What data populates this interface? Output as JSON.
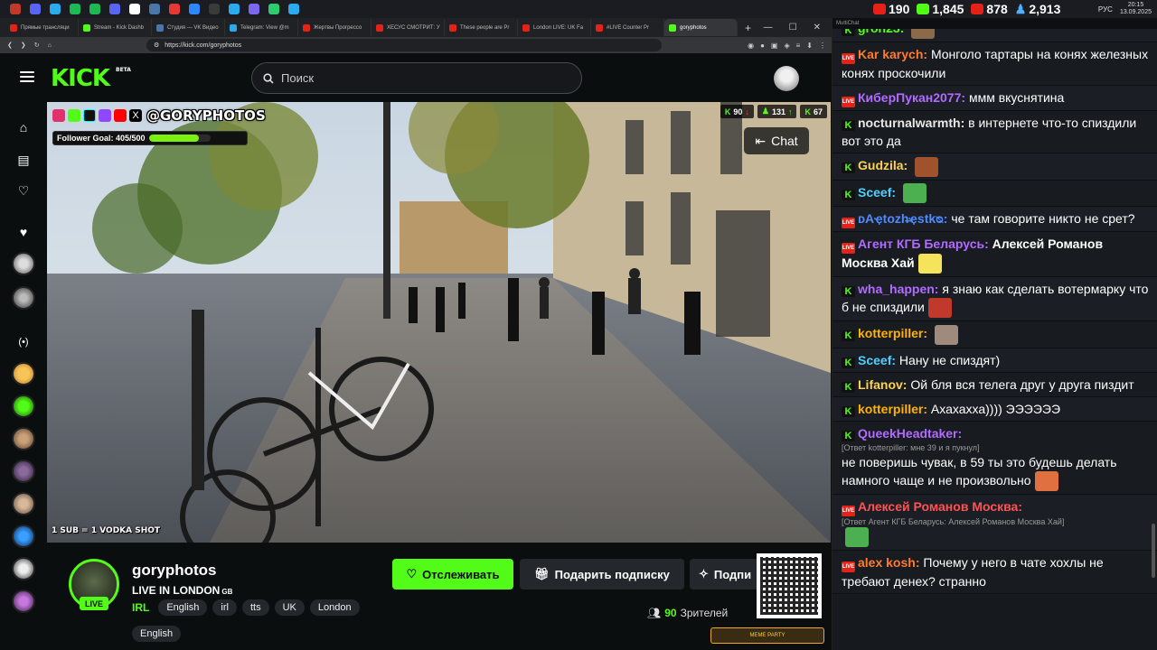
{
  "taskbar": {
    "icon_colors": [
      "#c0392b",
      "#5865f2",
      "#2aabee",
      "#1db954",
      "#1db954",
      "#5865f2",
      "#ffffff",
      "#4a76a8",
      "#e53935",
      "#2d88ff",
      "#3a3a3a",
      "#2aabee",
      "#7b68ee",
      "#2ecc71",
      "#2aabee"
    ],
    "time": "20:15",
    "date": "13.09.2025",
    "lang": "РУС"
  },
  "browser": {
    "tabs": [
      {
        "label": "Прямые трансляци",
        "color": "#e62117"
      },
      {
        "label": "Stream - Kick Dashb",
        "color": "#53fc18"
      },
      {
        "label": "Студия — VK Видео",
        "color": "#4a76a8"
      },
      {
        "label": "Telegram: View @m",
        "color": "#2aabee"
      },
      {
        "label": "Жертвы Прогрессо",
        "color": "#e62117"
      },
      {
        "label": "ХЕСУС СМОТРИТ: У",
        "color": "#e62117"
      },
      {
        "label": "These people are Pr",
        "color": "#e62117"
      },
      {
        "label": "London LIVE: UK Fa",
        "color": "#e62117"
      },
      {
        "label": "#LIVE Counter Pr",
        "color": "#e62117"
      },
      {
        "label": "goryphotos",
        "color": "#53fc18",
        "active": true
      }
    ],
    "url": "https://kick.com/goryphotos"
  },
  "kick": {
    "logo": "KICK",
    "logo_badge": "BETA",
    "search_placeholder": "Поиск"
  },
  "video": {
    "handle": "@GORYPHOTOS",
    "follower_goal_label": "Follower Goal: 405/500",
    "follower_goal_fraction": 0.81,
    "kick_count": "90",
    "viewers_up": "131",
    "kick_users": "67",
    "chat_button": "Chat",
    "sub_text": "1 SUB = 1 VODKA SHOT"
  },
  "channel": {
    "name": "goryphotos",
    "live_badge": "LIVE",
    "title": "LIVE IN LONDON",
    "country": "GB",
    "category": "IRL",
    "tags": [
      "English",
      "irl",
      "tts",
      "UK",
      "London"
    ],
    "extra_tag": "English",
    "follow_label": "Отслеживать",
    "gift_label": "Подарить подписку",
    "subscribe_label": "Подпи",
    "viewers_count": "90",
    "viewers_label": "Зрителей",
    "meme_label": "MEME PARTY"
  },
  "chat": {
    "header": "MultiChat",
    "counts": {
      "youtube": "190",
      "kick": "1,845",
      "vk": "878",
      "viewers": "2,913"
    },
    "messages": [
      {
        "platform": "kk",
        "user": "gron23:",
        "color": "#53fc18",
        "text": "",
        "emote": "#8a6a4a"
      },
      {
        "platform": "yt",
        "user": "Kar karych:",
        "color": "#ff7b2e",
        "text": "Монголо тартары на конях железных конях проскочили"
      },
      {
        "platform": "yt",
        "user": "КиберПукан2077:",
        "color": "#b26bff",
        "text": "ммм вкуснятина"
      },
      {
        "platform": "kk",
        "user": "nocturnalwarmth:",
        "color": "#e8e8e8",
        "text": "в интернете что-то спиздили вот это да"
      },
      {
        "platform": "kk",
        "user": "Gudzila:",
        "color": "#ffd24d",
        "text": "",
        "emote": "#a0522d"
      },
      {
        "platform": "kk",
        "user": "Sceef:",
        "color": "#4fd1ff",
        "text": "",
        "emote": "#4caf50"
      },
      {
        "platform": "yt",
        "user": "ᴅAҿtozh̶ҿstkᴓ:",
        "color": "#4f8bff",
        "text": "че там говорите никто не срет?"
      },
      {
        "platform": "yt",
        "user": "Агент КГБ Беларусь:",
        "color": "#b26bff",
        "text": "Алексей Романов Москва Хай",
        "bold_text": true,
        "emote": "#f5e35b"
      },
      {
        "platform": "kk",
        "user": "wha_happen:",
        "color": "#b26bff",
        "text": "я знаю как сделать вотермарку что б не спиздили",
        "emote": "#c0392b"
      },
      {
        "platform": "kk",
        "user": "kotterpiller:",
        "color": "#ffb300",
        "text": "",
        "emote": "#9e8b7e"
      },
      {
        "platform": "kk",
        "user": "Sceef:",
        "color": "#4fd1ff",
        "text": "Нану не спиздят)"
      },
      {
        "platform": "kk",
        "user": "Lifanov:",
        "color": "#ffd24d",
        "text": "Ой бля вся телега друг у друга пиздит"
      },
      {
        "platform": "kk",
        "user": "kotterpiller:",
        "color": "#ffb300",
        "text": "Ахахахха)))) ЭЭЭЭЭЭ"
      },
      {
        "platform": "kk",
        "user": "QueekHeadtaker:",
        "color": "#b26bff",
        "reply": "[Ответ kotterpiller: мне 39 и я пукнул]",
        "text": "не поверишь чувак, в 59 ты это будешь делать намного чаще и не произвольно",
        "emote": "#e07040"
      },
      {
        "platform": "yt",
        "user": "Алексей Романов Москва:",
        "color": "#ff5252",
        "reply": "[Ответ Агент КГБ Беларусь: Алексей Романов Москва Хай]",
        "text": "",
        "emote": "#4caf50"
      },
      {
        "platform": "yt",
        "user": "alex kosh:",
        "color": "#ff7b2e",
        "text": "Почему у него в чате хохлы не требают денех? странно"
      }
    ]
  }
}
